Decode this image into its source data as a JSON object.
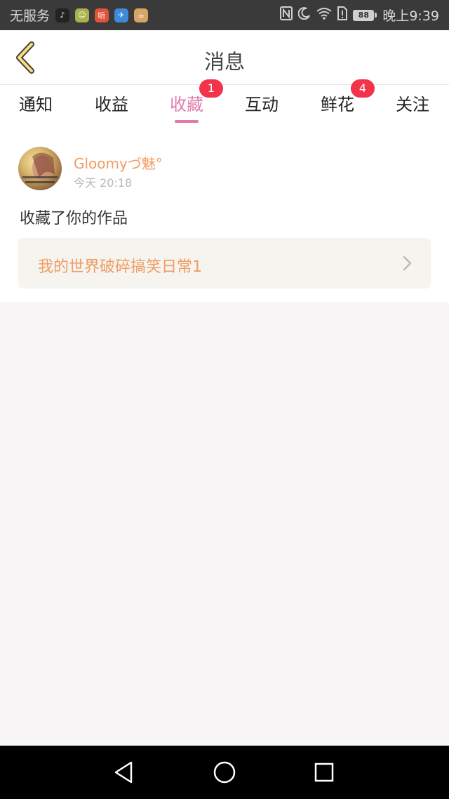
{
  "status_bar": {
    "carrier": "无服务",
    "app_icons": [
      {
        "name": "tiktok-icon",
        "glyph": "♪",
        "color": "#222222"
      },
      {
        "name": "chat-icon",
        "glyph": "☺",
        "color": "#a8b14a"
      },
      {
        "name": "listen-app-icon",
        "glyph": "听",
        "color": "#e0543b"
      },
      {
        "name": "bird-app-icon",
        "glyph": "✈",
        "color": "#3d8ad8"
      },
      {
        "name": "cup-app-icon",
        "glyph": "☕",
        "color": "#d8a466"
      }
    ],
    "battery": "88",
    "time": "晚上9:39"
  },
  "header": {
    "title": "消息"
  },
  "tabs": [
    {
      "label": "通知",
      "badge": ""
    },
    {
      "label": "收益",
      "badge": ""
    },
    {
      "label": "收藏",
      "badge": "1",
      "active": true
    },
    {
      "label": "互动",
      "badge": ""
    },
    {
      "label": "鲜花",
      "badge": "4"
    },
    {
      "label": "关注",
      "badge": ""
    }
  ],
  "message": {
    "username": "Gloomyづ魅°",
    "time": "今天 20:18",
    "action": "收藏了你的作品",
    "work_title": "我的世界破碎搞笑日常1"
  },
  "colors": {
    "accent_pink": "#e07cad",
    "username_orange": "#f29b62",
    "badge_red": "#f2334a"
  }
}
